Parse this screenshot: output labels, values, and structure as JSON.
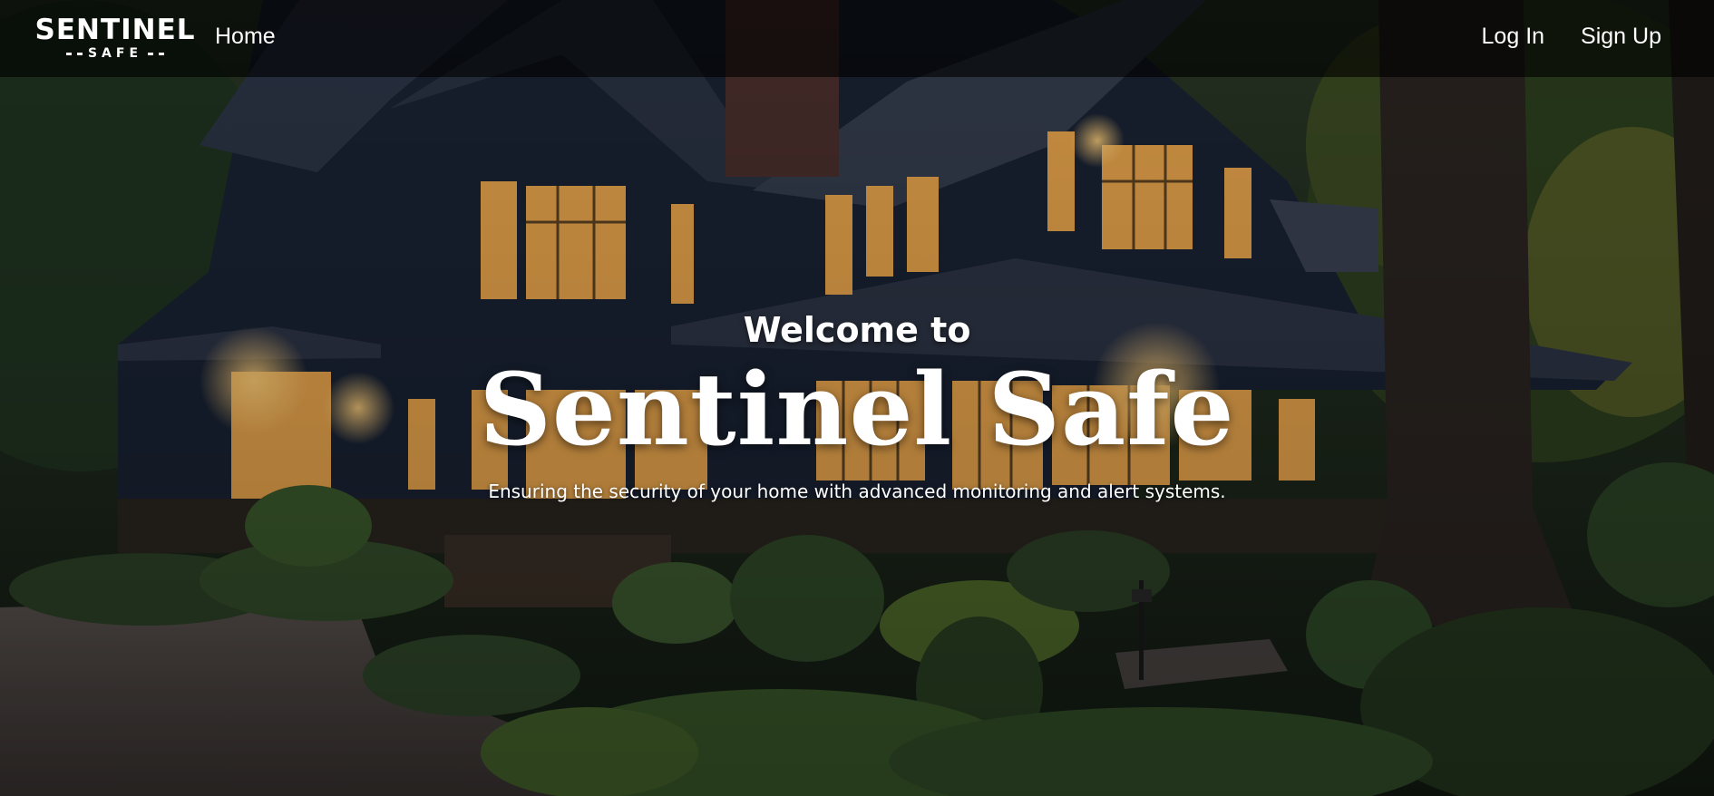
{
  "nav": {
    "logo": {
      "main": "SENTINEL",
      "sub": "SAFE"
    },
    "home_label": "Home",
    "login_label": "Log In",
    "signup_label": "Sign Up"
  },
  "hero": {
    "welcome": "Welcome to",
    "title": "Sentinel Safe",
    "tagline": "Ensuring the security of your home with advanced monitoring and alert systems."
  },
  "colors": {
    "nav_background": "#000000",
    "text": "#ffffff",
    "window_glow": "#f2b45a",
    "house_body": "#1b2436",
    "foliage": "#2f4a2a"
  }
}
